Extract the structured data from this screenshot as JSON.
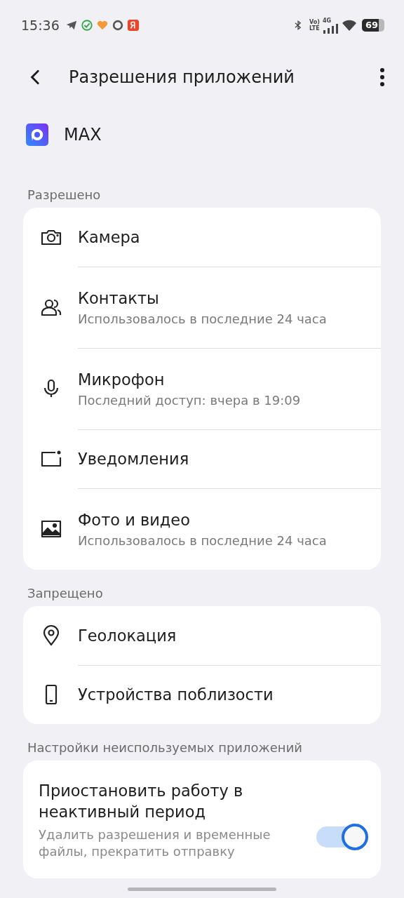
{
  "status_bar": {
    "time": "15:36",
    "network_top": "Vo)",
    "network_bottom": "LTE",
    "network_type": "4G",
    "battery": "69"
  },
  "header": {
    "title": "Разрешения приложений"
  },
  "app": {
    "name": "MAX"
  },
  "sections": [
    {
      "title": "Разрешено",
      "items": [
        {
          "kind": "camera",
          "title": "Камера"
        },
        {
          "kind": "contacts",
          "title": "Контакты",
          "subtitle": "Использовалось в последние 24 часа"
        },
        {
          "kind": "microphone",
          "title": "Микрофон",
          "subtitle": "Последний доступ: вчера в 19:09"
        },
        {
          "kind": "notifications",
          "title": "Уведомления"
        },
        {
          "kind": "media",
          "title": "Фото и видео",
          "subtitle": "Использовалось в последние 24 часа"
        }
      ]
    },
    {
      "title": "Запрещено",
      "items": [
        {
          "kind": "location",
          "title": "Геолокация"
        },
        {
          "kind": "nearby",
          "title": "Устройства поблизости"
        }
      ]
    }
  ],
  "unused": {
    "title": "Настройки неиспользуемых приложений",
    "setting_title": "Приостановить работу в неактивный период",
    "setting_description": "Удалить разрешения и временные файлы, прекратить отправку",
    "on": true
  }
}
